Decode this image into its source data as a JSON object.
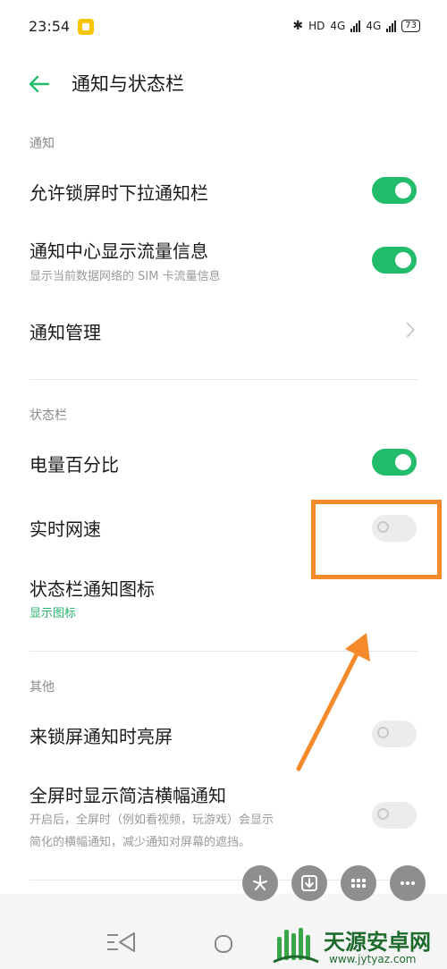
{
  "status_bar": {
    "time": "23:54",
    "network_label": "HD",
    "signal_labels": [
      "4G",
      "4G"
    ],
    "battery": "73"
  },
  "header": {
    "title": "通知与状态栏"
  },
  "sections": [
    {
      "label": "通知",
      "rows": [
        {
          "label": "允许锁屏时下拉通知栏",
          "toggle": true
        },
        {
          "label": "通知中心显示流量信息",
          "sub": "显示当前数据网络的 SIM 卡流量信息",
          "toggle": true
        },
        {
          "label": "通知管理",
          "chevron": true
        }
      ]
    },
    {
      "label": "状态栏",
      "rows": [
        {
          "label": "电量百分比",
          "toggle": true
        },
        {
          "label": "实时网速",
          "toggle": false
        },
        {
          "label": "状态栏通知图标",
          "sub": "显示图标"
        }
      ]
    },
    {
      "label": "其他",
      "rows": [
        {
          "label": "来锁屏通知时亮屏",
          "toggle": false
        },
        {
          "label": "全屏时显示简洁横幅通知",
          "sub_lines": [
            "开启后，全屏时（例如看视频，玩游戏）会显示",
            "简化的横幅通知，减少通知对屏幕的遮挡。"
          ],
          "toggle": false
        }
      ]
    }
  ],
  "watermark": {
    "title": "天源安卓网",
    "url": "www.jytyaz.com"
  },
  "colors": {
    "accent": "#22bd6b",
    "annotation": "#f58a2b",
    "toggle_off": "#ececec"
  }
}
